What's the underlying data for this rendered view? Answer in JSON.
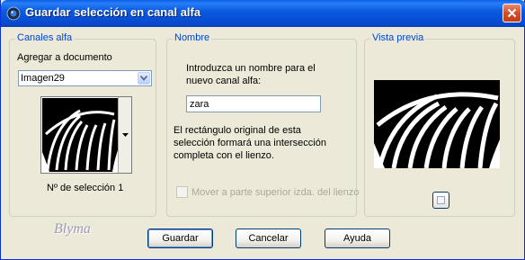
{
  "window": {
    "title": "Guardar selección en canal alfa"
  },
  "channels_group": {
    "label": "Canales alfa",
    "add_to_document_label": "Agregar a documento",
    "document_select_value": "Imagen29",
    "selection_number_label": "Nº de selección 1"
  },
  "name_group": {
    "label": "Nombre",
    "instruction": [
      "Introduzca un nombre para el",
      "nuevo canal alfa:"
    ],
    "name_value": "zara",
    "info": [
      "El rectángulo original de esta",
      "selección formará una intersección",
      "completa con el lienzo."
    ],
    "move_checkbox_label": "Mover a parte superior izda. del lienzo",
    "move_checkbox_checked": false
  },
  "preview_group": {
    "label": "Vista previa"
  },
  "buttons": {
    "save": "Guardar",
    "cancel": "Cancelar",
    "help": "Ayuda"
  },
  "watermark": "Blyma"
}
